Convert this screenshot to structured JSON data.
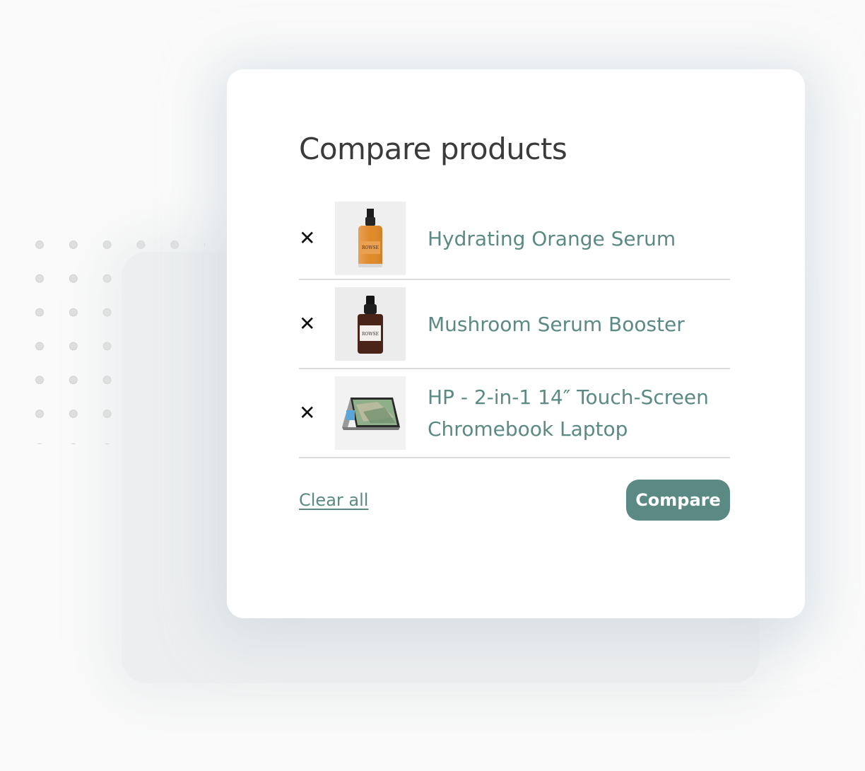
{
  "modal": {
    "title": "Compare products",
    "items": [
      {
        "name": "Hydrating Orange Serum",
        "remove": "✕",
        "image": "orange-serum-bottle"
      },
      {
        "name": "Mushroom Serum Booster",
        "remove": "✕",
        "image": "mushroom-serum-bottle"
      },
      {
        "name": "HP - 2-in-1 14″ Touch-Screen Chromebook Laptop",
        "remove": "✕",
        "image": "chromebook-laptop"
      }
    ],
    "clear_all": "Clear all",
    "compare_label": "Compare"
  },
  "colors": {
    "accent": "#5a8a83",
    "title": "#3b3b3b",
    "divider": "#dcdcdc"
  }
}
